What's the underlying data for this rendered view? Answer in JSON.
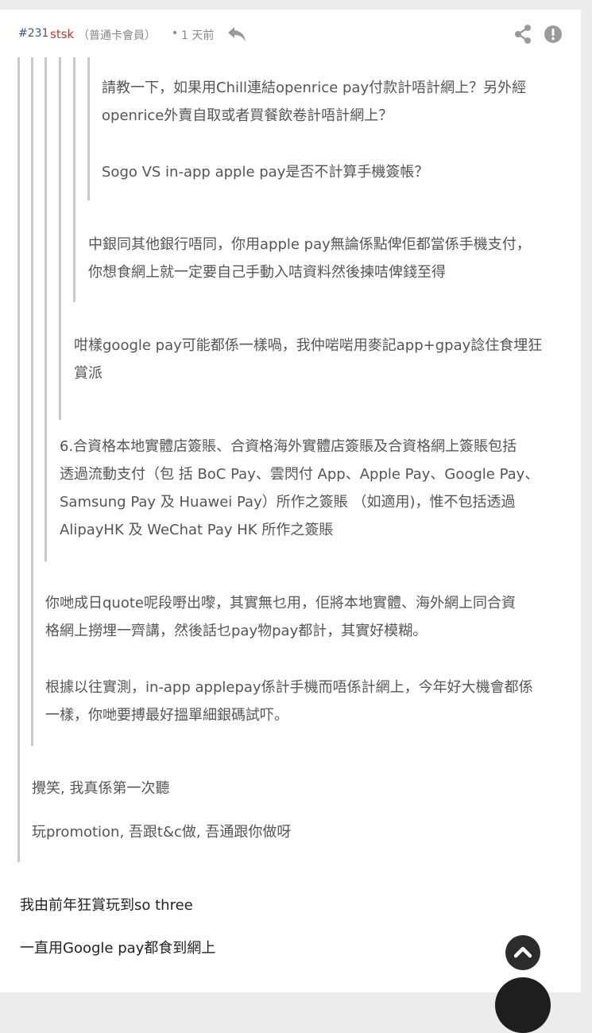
{
  "post": {
    "number": "#231",
    "username": "stsk",
    "role": "（普通卡會員）",
    "separator": "•",
    "time": "1 天前"
  },
  "icons": {
    "reply": "reply-arrow-icon",
    "share": "share-icon",
    "report": "exclamation-icon",
    "scroll_top": "chevron-up-icon"
  },
  "quotes": {
    "q1": {
      "p1": [
        "請教一下，如果用Chill連結openrice pay付款計唔計網上？另外經",
        "openrice外賣自取或者買餐飲卷計唔計網上？"
      ],
      "p2": "Sogo VS in-app apple pay是否不計算手機簽帳？"
    },
    "q2": {
      "p1": [
        "中銀同其他銀行唔同，你用apple pay無論係點俾佢都當係手機支付，",
        "你想食網上就一定要自己手動入咭資料然後揀咭俾錢至得"
      ]
    },
    "q3": {
      "p1": [
        "咁樣google pay可能都係一樣喎，我仲啱啱用麥記app+gpay諗住食埋狂",
        "賞派"
      ]
    },
    "q4": {
      "p1": [
        "6.合資格本地實體店簽賬、合資格海外實體店簽賬及合資格網上簽賬包括",
        "透過流動支付（包 括 BoC Pay、雲閃付 App、Apple Pay、Google Pay、",
        "Samsung Pay 及 Huawei Pay）所作之簽賬 （如適用)，惟不包括透過",
        "AlipayHK 及 WeChat Pay HK 所作之簽賬"
      ]
    },
    "q5": {
      "p1": [
        "你哋成日quote呢段嘢出嚟，其實無乜用，佢將本地實體、海外網上同合資",
        "格網上撈埋一齊講，然後話乜pay物pay都計，其實好模糊。"
      ],
      "p2": [
        "根據以往實測，in-app applepay係計手機而唔係計網上，今年好大機會都係",
        "一樣，你哋要搏最好搵單細銀碼試吓。"
      ]
    },
    "q6": {
      "p1": "攪笑, 我真係第一次聽",
      "p2": "玩promotion, 吾跟t&c做, 吾通跟你做呀"
    }
  },
  "reply": {
    "p1": "我由前年狂賞玩到so three",
    "p2": "一直用Google pay都食到網上"
  },
  "colors": {
    "username": "#c0392b",
    "quote_bar": "#c8c8c8",
    "fab": "#2c2c2c"
  }
}
